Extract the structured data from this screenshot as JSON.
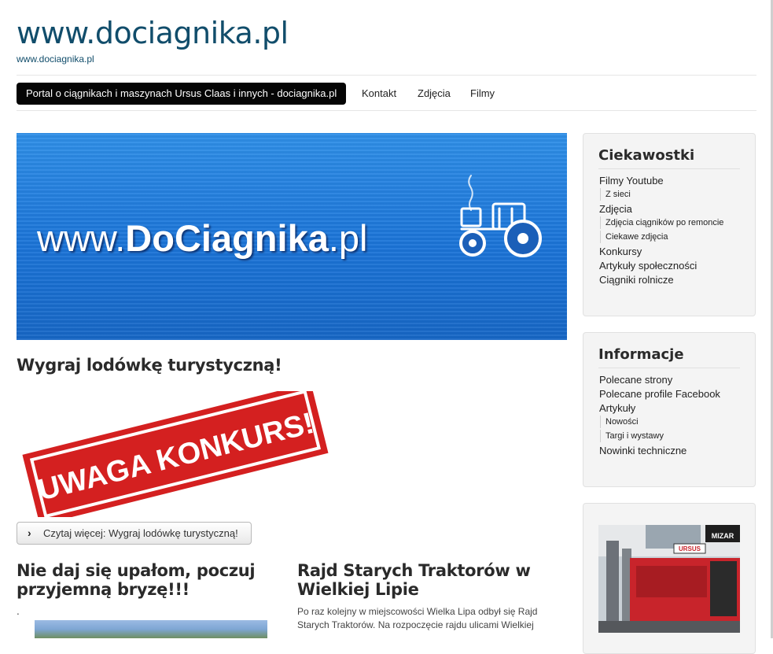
{
  "site": {
    "title": "www.dociagnika.pl",
    "description": "www.dociagnika.pl"
  },
  "nav": {
    "items": [
      "Portal o ciągnikach i maszynach Ursus Claas i innych - dociagnika.pl",
      "Kontakt",
      "Zdjęcia",
      "Filmy"
    ]
  },
  "banner": {
    "text_prefix": "www.",
    "text_bold": "DoCiagnika",
    "text_suffix": ".pl"
  },
  "featured": {
    "title": "Wygraj lodówkę turystyczną!",
    "stamp_text": "UWAGA KONKURS!",
    "readmore": "Czytaj więcej: Wygraj lodówkę turystyczną!"
  },
  "articles": {
    "left_title": "Nie daj się upałom, poczuj przyjemną bryzę!!!",
    "left_dot": ".",
    "right_title": "Rajd Starych Traktorów w Wielkiej Lipie",
    "right_text": "Po raz kolejny w miejscowości Wielka Lipa odbył się Rajd Starych Traktorów. Na rozpoczęcie rajdu ulicami Wielkiej"
  },
  "sidebar": {
    "ciekawostki": {
      "title": "Ciekawostki",
      "items": [
        "Filmy Youtube",
        "Z sieci",
        "Zdjęcia",
        "Zdjęcia ciągników po remoncie",
        "Ciekawe zdjęcia",
        "Konkursy",
        "Artykuły społeczności",
        "Ciągniki rolnicze"
      ]
    },
    "informacje": {
      "title": "Informacje",
      "items": [
        "Polecane strony",
        "Polecane profile Facebook",
        "Artykuły",
        "Nowości",
        "Targi i wystawy",
        "Nowinki techniczne"
      ]
    },
    "ad": {
      "logo": "MIZAR",
      "badge": "URSUS"
    }
  },
  "colors": {
    "title": "#114d6b",
    "nav_active_bg": "#050505",
    "banner_blue": "#1b74d8",
    "stamp_red": "#d42020"
  }
}
